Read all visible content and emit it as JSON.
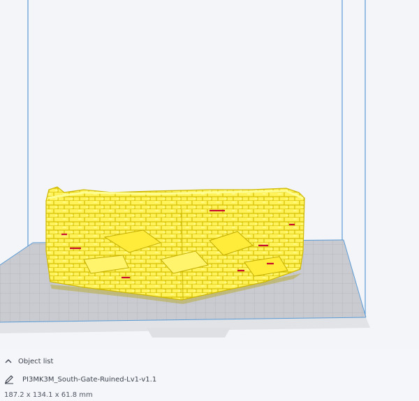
{
  "viewport": {
    "build_volume_color": "#5b9bd5",
    "plate_color": "#c7c9cf",
    "model_color": "#fff25a",
    "model_shadow_color": "#d8c300",
    "overhang_color": "#c8102e",
    "plate_grid_color": "#a9acb4"
  },
  "object_list": {
    "header_label": "Object list",
    "header_icon": "chevron-up-icon",
    "edit_icon": "pencil-icon",
    "file_name": "PI3MK3M_South-Gate-Ruined-Lv1-v1.1",
    "dimensions": "187.2 x 134.1 x 61.8 mm"
  }
}
